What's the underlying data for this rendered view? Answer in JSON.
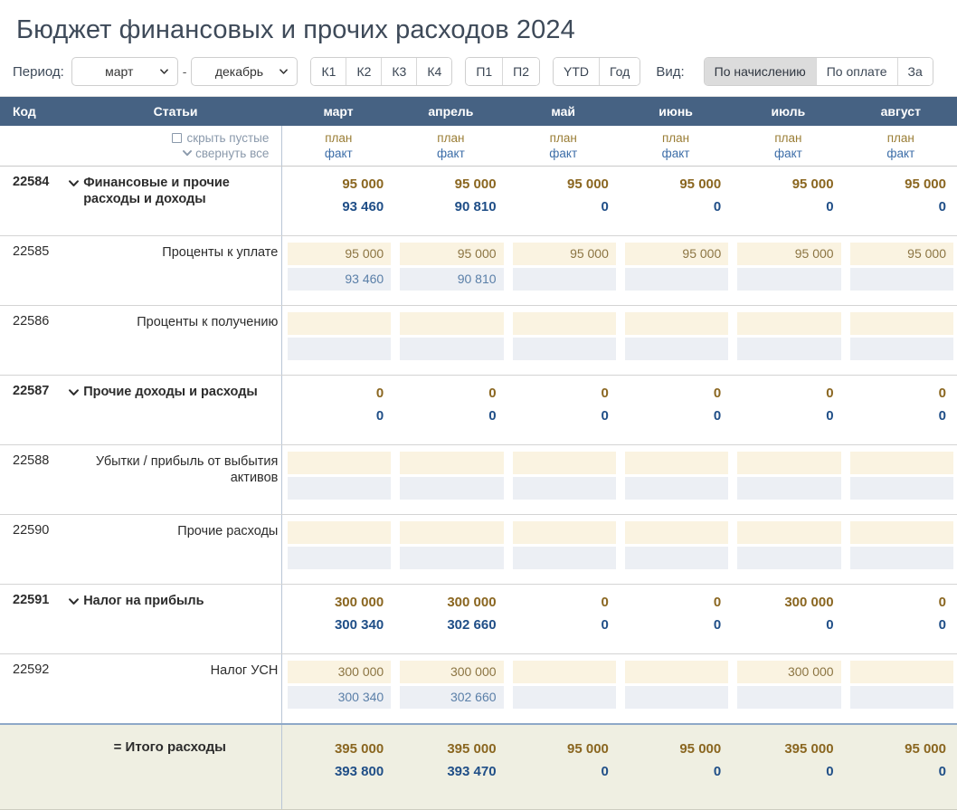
{
  "page": {
    "title": "Бюджет финансовых и прочих расходов 2024"
  },
  "toolbar": {
    "period_label": "Период:",
    "period_from": "март",
    "period_to": "декабрь",
    "dash": "-",
    "quarter_buttons": [
      "К1",
      "К2",
      "К3",
      "К4"
    ],
    "half_buttons": [
      "П1",
      "П2"
    ],
    "range_buttons": [
      "YTD",
      "Год"
    ],
    "view_label": "Вид:",
    "view_buttons": [
      "По начислению",
      "По оплате",
      "За"
    ],
    "view_active": "По начислению"
  },
  "table": {
    "headers": {
      "code": "Код",
      "item": "Статьи",
      "months": [
        "март",
        "апрель",
        "май",
        "июнь",
        "июль",
        "август"
      ]
    },
    "tools": {
      "hide_empty": "скрыть пустые",
      "collapse_all": "свернуть все",
      "checkbox_icon": "checkbox-empty-icon",
      "chevron_icon": "chevron-down-icon"
    },
    "plan_label": "план",
    "fact_label": "факт",
    "rows": [
      {
        "code": "22584",
        "label": "Финансовые и прочие расходы и доходы",
        "type": "group",
        "expanded": true,
        "plan": [
          "95 000",
          "95 000",
          "95 000",
          "95 000",
          "95 000",
          "95 000"
        ],
        "fact": [
          "93 460",
          "90 810",
          "0",
          "0",
          "0",
          "0"
        ]
      },
      {
        "code": "22585",
        "label": "Проценты к уплате",
        "type": "child",
        "plan": [
          "95 000",
          "95 000",
          "95 000",
          "95 000",
          "95 000",
          "95 000"
        ],
        "fact": [
          "93 460",
          "90 810",
          "",
          "",
          "",
          ""
        ]
      },
      {
        "code": "22586",
        "label": "Проценты к получению",
        "type": "child",
        "plan": [
          "",
          "",
          "",
          "",
          "",
          ""
        ],
        "fact": [
          "",
          "",
          "",
          "",
          "",
          ""
        ]
      },
      {
        "code": "22587",
        "label": "Прочие доходы и расходы",
        "type": "group",
        "expanded": true,
        "plan": [
          "0",
          "0",
          "0",
          "0",
          "0",
          "0"
        ],
        "fact": [
          "0",
          "0",
          "0",
          "0",
          "0",
          "0"
        ]
      },
      {
        "code": "22588",
        "label": "Убытки / прибыль от выбытия активов",
        "type": "child",
        "plan": [
          "",
          "",
          "",
          "",
          "",
          ""
        ],
        "fact": [
          "",
          "",
          "",
          "",
          "",
          ""
        ]
      },
      {
        "code": "22590",
        "label": "Прочие расходы",
        "type": "child",
        "plan": [
          "",
          "",
          "",
          "",
          "",
          ""
        ],
        "fact": [
          "",
          "",
          "",
          "",
          "",
          ""
        ]
      },
      {
        "code": "22591",
        "label": "Налог на прибыль",
        "type": "group",
        "expanded": true,
        "plan": [
          "300 000",
          "300 000",
          "0",
          "0",
          "300 000",
          "0"
        ],
        "fact": [
          "300 340",
          "302 660",
          "0",
          "0",
          "0",
          "0"
        ]
      },
      {
        "code": "22592",
        "label": "Налог УСН",
        "type": "child",
        "plan": [
          "300 000",
          "300 000",
          "",
          "",
          "300 000",
          ""
        ],
        "fact": [
          "300 340",
          "302 660",
          "",
          "",
          "",
          ""
        ]
      }
    ],
    "total": {
      "code": "",
      "label": "= Итого расходы",
      "type": "total",
      "plan": [
        "395 000",
        "395 000",
        "95 000",
        "95 000",
        "395 000",
        "95 000"
      ],
      "fact": [
        "393 800",
        "393 470",
        "0",
        "0",
        "0",
        "0"
      ]
    }
  },
  "colors": {
    "header_bg": "#466283",
    "plan_text": "#8a6620",
    "fact_text": "#1f4e87",
    "plan_cell_bg": "#faf3e1",
    "fact_cell_bg": "#eceff4",
    "total_bg": "#efefe2"
  }
}
